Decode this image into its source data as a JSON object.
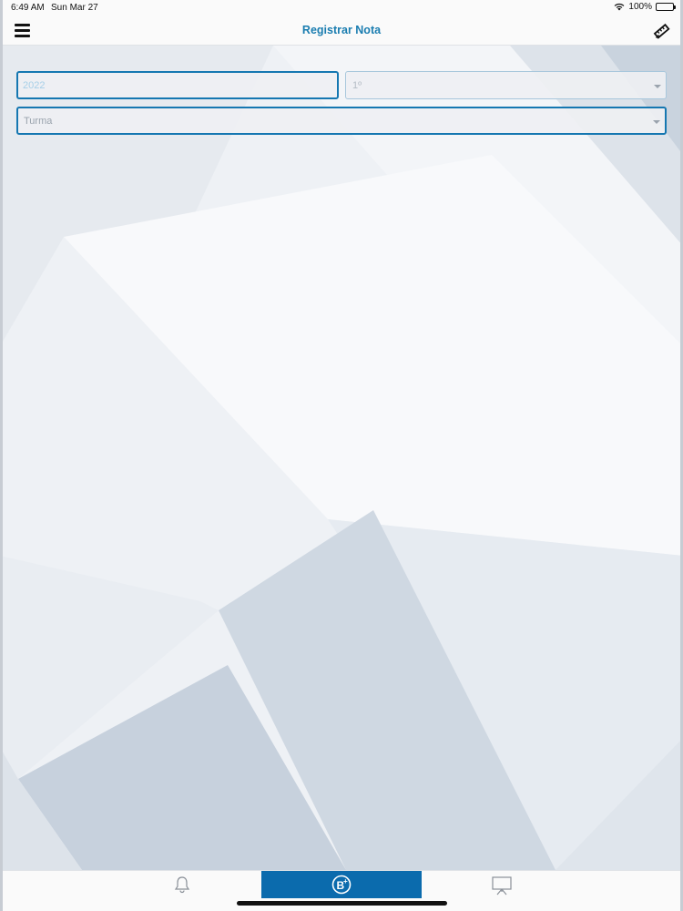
{
  "status_bar": {
    "time": "6:49 AM",
    "date": "Sun Mar 27",
    "battery": "100%"
  },
  "nav": {
    "title": "Registrar Nota",
    "menu_icon": "hamburger-menu-icon",
    "edit_icon": "pencil-ruler-icon"
  },
  "form": {
    "year_value": "2022",
    "bimestre_value": "1º",
    "turma_placeholder": "Turma"
  },
  "tabs": [
    {
      "name": "notifications",
      "icon": "bell-icon",
      "active": false
    },
    {
      "name": "grades",
      "icon": "b-plus-icon",
      "active": true
    },
    {
      "name": "presentation",
      "icon": "presentation-board-icon",
      "active": false
    }
  ],
  "colors": {
    "accent": "#1577b1",
    "title": "#1a7db0",
    "active_tab": "#0b6bad"
  }
}
